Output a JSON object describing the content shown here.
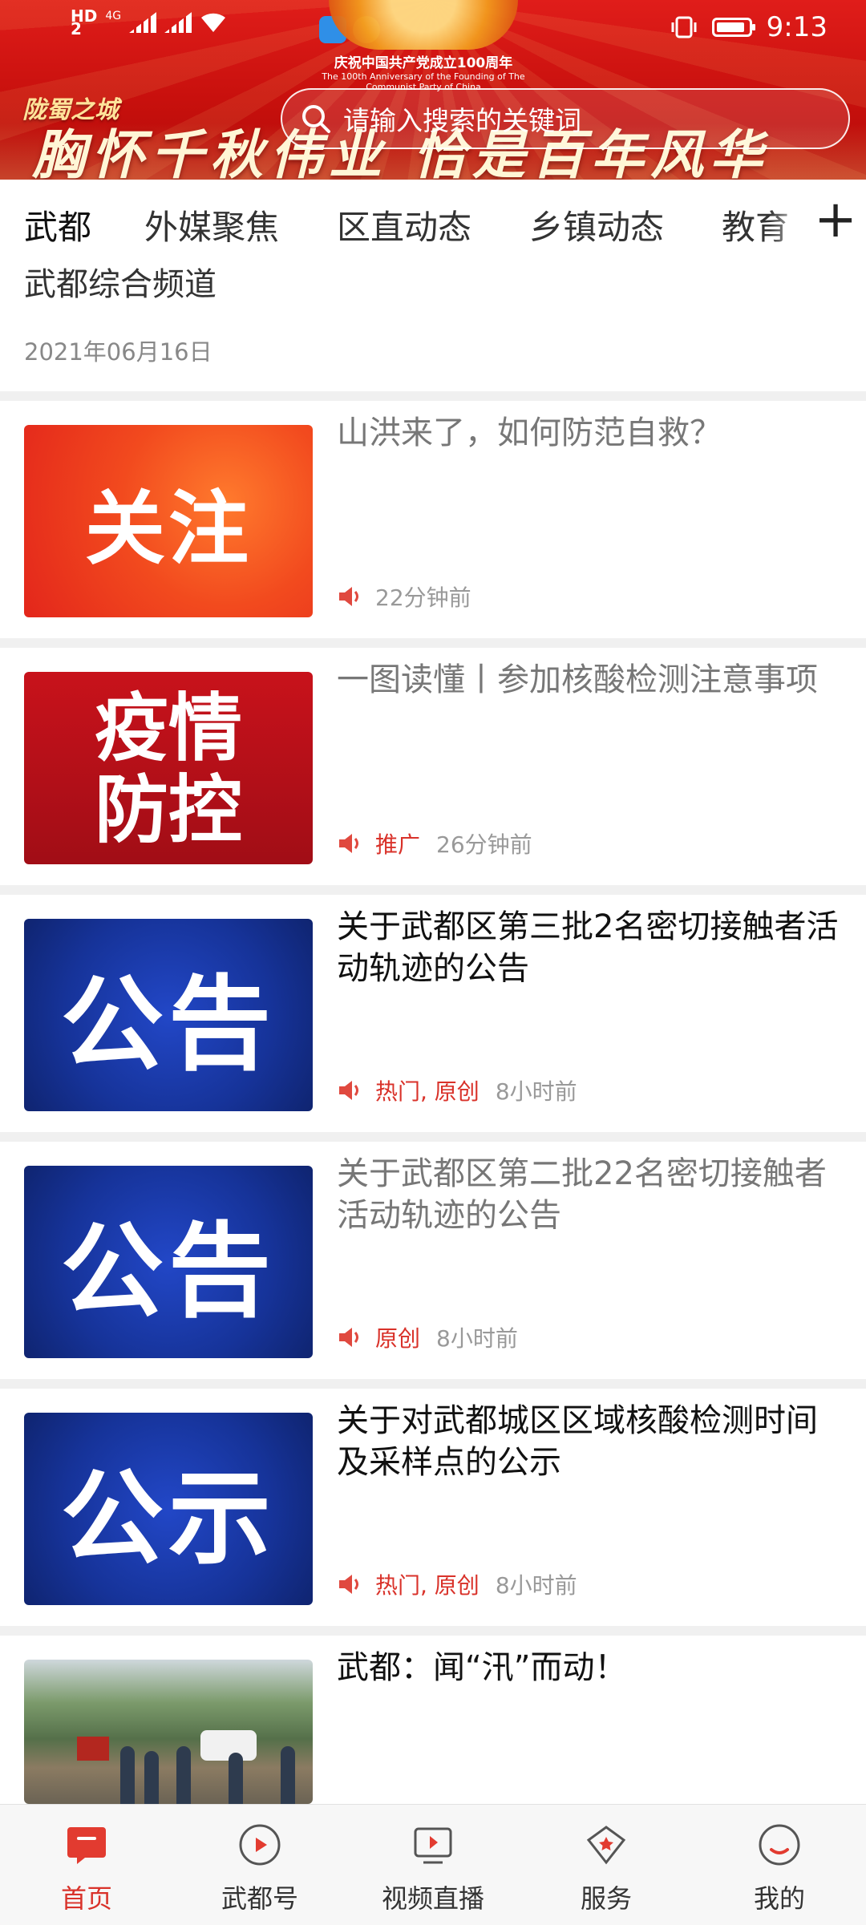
{
  "status_bar": {
    "hd": "HD",
    "hd_sub": "2",
    "network": "4G",
    "time": "9:13"
  },
  "banner": {
    "anniv_cn": "庆祝中国共产党成立100周年",
    "anniv_en": "The 100th Anniversary of the Founding of The Communist Party of China",
    "logo": "陇蜀之城",
    "slogan": "胸怀千秋伟业 恰是百年风华"
  },
  "search": {
    "placeholder": "请输入搜索的关键词"
  },
  "tabs": [
    {
      "label": "武都",
      "active": true
    },
    {
      "label": "外媒聚焦"
    },
    {
      "label": "区直动态"
    },
    {
      "label": "乡镇动态"
    },
    {
      "label": "教育"
    }
  ],
  "top_card": {
    "title": "武都综合频道",
    "date": "2021年06月16日"
  },
  "news": [
    {
      "thumb_text": "关注",
      "title": "山洪来了，如何防范自救？",
      "tags": "",
      "time": "22分钟前"
    },
    {
      "thumb_text": "疫情防控",
      "title": "一图读懂丨参加核酸检测注意事项",
      "tags": "推广",
      "time": "26分钟前"
    },
    {
      "thumb_text": "公告",
      "title": "关于武都区第三批2名密切接触者活动轨迹的公告",
      "tags": "热门, 原创",
      "time": "8小时前"
    },
    {
      "thumb_text": "公告",
      "title": "关于武都区第二批22名密切接触者活动轨迹的公告",
      "tags": "原创",
      "time": "8小时前"
    },
    {
      "thumb_text": "公示",
      "title": "关于对武都城区区域核酸检测时间及采样点的公示",
      "tags": "热门, 原创",
      "time": "8小时前"
    },
    {
      "thumb_text": "",
      "title": "武都：闻“汛”而动！",
      "tags": "",
      "time": ""
    }
  ],
  "bottom_nav": [
    {
      "label": "首页",
      "icon": "home-icon",
      "active": true
    },
    {
      "label": "武都号",
      "icon": "play-circle-icon"
    },
    {
      "label": "视频直播",
      "icon": "video-live-icon"
    },
    {
      "label": "服务",
      "icon": "service-star-icon"
    },
    {
      "label": "我的",
      "icon": "profile-icon"
    }
  ],
  "colors": {
    "accent": "#d9322a",
    "banner_red": "#c8100d",
    "notice_blue": "#163399"
  }
}
